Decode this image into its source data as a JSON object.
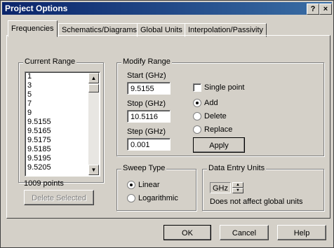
{
  "window": {
    "title": "Project Options",
    "help_btn": "?",
    "close_btn": "×"
  },
  "tabs": [
    {
      "label": "Frequencies",
      "active": true
    },
    {
      "label": "Schematics/Diagrams"
    },
    {
      "label": "Global Units"
    },
    {
      "label": "Interpolation/Passivity"
    }
  ],
  "current_range": {
    "legend": "Current Range",
    "items": [
      "1",
      "3",
      "5",
      "7",
      "9",
      "9.5155",
      "9.5165",
      "9.5175",
      "9.5185",
      "9.5195",
      "9.5205"
    ],
    "count_text": "1009 points",
    "delete_label": "Delete Selected"
  },
  "modify_range": {
    "legend": "Modify Range",
    "start_label": "Start (GHz)",
    "start_value": "9.5155",
    "stop_label": "Stop (GHz)",
    "stop_value": "10.5116",
    "step_label": "Step (GHz)",
    "step_value": "0.001",
    "single_point_label": "Single point",
    "add_label": "Add",
    "delete_label": "Delete",
    "replace_label": "Replace",
    "apply_label": "Apply"
  },
  "sweep_type": {
    "legend": "Sweep Type",
    "linear_label": "Linear",
    "log_label": "Logarithmic"
  },
  "data_entry": {
    "legend": "Data Entry Units",
    "unit_value": "GHz",
    "note": "Does not affect global units"
  },
  "footer": {
    "ok_label": "OK",
    "cancel_label": "Cancel",
    "help_label": "Help"
  }
}
